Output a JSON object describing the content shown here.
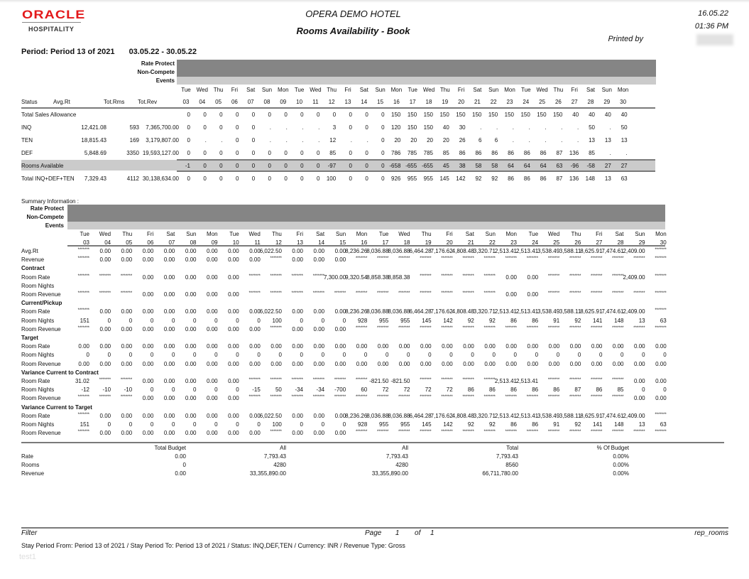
{
  "header": {
    "logo_brand": "ORACLE",
    "logo_sub": "HOSPITALITY",
    "hotel_name": "OPERA DEMO HOTEL",
    "report_title": "Rooms Availability - Book",
    "print_date": "16.05.22",
    "print_time": "01:36 PM",
    "printed_by_label": "Printed by",
    "period_label": "Period: Period 13 of 2021",
    "period_range": "03.05.22 - 30.05.22"
  },
  "bands": {
    "rate_protect": "Rate Protect",
    "non_compete": "Non-Compete",
    "events": "Events"
  },
  "days": [
    {
      "dow": "Tue",
      "d": "03"
    },
    {
      "dow": "Wed",
      "d": "04"
    },
    {
      "dow": "Thu",
      "d": "05"
    },
    {
      "dow": "Fri",
      "d": "06"
    },
    {
      "dow": "Sat",
      "d": "07"
    },
    {
      "dow": "Sun",
      "d": "08"
    },
    {
      "dow": "Mon",
      "d": "09"
    },
    {
      "dow": "Tue",
      "d": "10"
    },
    {
      "dow": "Wed",
      "d": "11"
    },
    {
      "dow": "Thu",
      "d": "12"
    },
    {
      "dow": "Fri",
      "d": "13"
    },
    {
      "dow": "Sat",
      "d": "14"
    },
    {
      "dow": "Sun",
      "d": "15"
    },
    {
      "dow": "Mon",
      "d": "16"
    },
    {
      "dow": "Tue",
      "d": "17"
    },
    {
      "dow": "Wed",
      "d": "18"
    },
    {
      "dow": "Thu",
      "d": "19"
    },
    {
      "dow": "Fri",
      "d": "20"
    },
    {
      "dow": "Sat",
      "d": "21"
    },
    {
      "dow": "Sun",
      "d": "22"
    },
    {
      "dow": "Mon",
      "d": "23"
    },
    {
      "dow": "Tue",
      "d": "24"
    },
    {
      "dow": "Wed",
      "d": "25"
    },
    {
      "dow": "Thu",
      "d": "26"
    },
    {
      "dow": "Fri",
      "d": "27"
    },
    {
      "dow": "Sat",
      "d": "28"
    },
    {
      "dow": "Sun",
      "d": "29"
    },
    {
      "dow": "Mon",
      "d": "30"
    }
  ],
  "main_table": {
    "columns": {
      "status": "Status",
      "avg_rt": "Avg.Rt",
      "tot_rms": "Tot.Rms",
      "tot_rev": "Tot.Rev"
    },
    "rows": [
      {
        "label": "Total Sales Allowance",
        "avg": "",
        "rms": "",
        "rev": "",
        "shaded": false,
        "vals": [
          "0",
          "0",
          "0",
          "0",
          "0",
          "0",
          "0",
          "0",
          "0",
          "0",
          "0",
          "0",
          "0",
          "150",
          "150",
          "150",
          "150",
          "150",
          "150",
          "150",
          "150",
          "150",
          "150",
          "150",
          "40",
          "40",
          "40",
          "40"
        ]
      },
      {
        "label": "INQ",
        "avg": "12,421.08",
        "rms": "593",
        "rev": "7,365,700.00",
        "shaded": false,
        "vals": [
          "0",
          "0",
          "0",
          "0",
          "0",
          ".",
          ".",
          ".",
          ".",
          "3",
          "0",
          "0",
          "0",
          "120",
          "150",
          "150",
          "40",
          "30",
          ".",
          ".",
          ".",
          ".",
          ".",
          ".",
          ".",
          "50",
          ".",
          "50"
        ]
      },
      {
        "label": "TEN",
        "avg": "18,815.43",
        "rms": "169",
        "rev": "3,179,807.00",
        "shaded": false,
        "vals": [
          "0",
          ".",
          ".",
          "0",
          "0",
          ".",
          ".",
          ".",
          ".",
          "12",
          ".",
          ".",
          "0",
          "20",
          "20",
          "20",
          "20",
          "26",
          "6",
          "6",
          ".",
          ".",
          ".",
          ".",
          ".",
          "13",
          "13",
          "13"
        ]
      },
      {
        "label": "DEF",
        "avg": "5,848.69",
        "rms": "3350",
        "rev": "19,593,127.00",
        "shaded": false,
        "vals": [
          "0",
          "0",
          "0",
          "0",
          "0",
          "0",
          "0",
          "0",
          "0",
          "85",
          "0",
          "0",
          "0",
          "786",
          "785",
          "785",
          "85",
          "86",
          "86",
          "86",
          "86",
          "86",
          "86",
          "87",
          "136",
          "85",
          ".",
          "."
        ]
      },
      {
        "label": "Rooms Available",
        "avg": "",
        "rms": "",
        "rev": "",
        "shaded": true,
        "vals": [
          "-1",
          "0",
          "0",
          "0",
          "0",
          "0",
          "0",
          "0",
          "0",
          "-97",
          "0",
          "0",
          "0",
          "-658",
          "-655",
          "-655",
          "45",
          "38",
          "58",
          "58",
          "64",
          "64",
          "64",
          "63",
          "-96",
          "-58",
          "27",
          "27"
        ]
      },
      {
        "label": "Total INQ+DEF+TEN",
        "avg": "7,329.43",
        "rms": "4112",
        "rev": "30,138,634.00",
        "shaded": false,
        "vals": [
          "0",
          "0",
          "0",
          "0",
          "0",
          "0",
          "0",
          "0",
          "0",
          "100",
          "0",
          "0",
          "0",
          "926",
          "955",
          "955",
          "145",
          "142",
          "92",
          "92",
          "86",
          "86",
          "86",
          "87",
          "136",
          "148",
          "13",
          "63"
        ]
      }
    ]
  },
  "summary": {
    "title": "Summary Information :",
    "rows": [
      {
        "label": "Avg.Rt",
        "bold": false,
        "vals": [
          "*******",
          "0.00",
          "0.00",
          "0.00",
          "0.00",
          "0.00",
          "0.00",
          "0.00",
          "0.00",
          "6,022.50",
          "0.00",
          "0.00",
          "0.00",
          "8,236.26",
          "8,036.88",
          "8,036.88",
          "6,464.28",
          "7,176.62",
          "4,808.48",
          "3,320.71",
          "2,513.41",
          "2,513.41",
          "3,538.49",
          "3,588.11",
          "8,625.91",
          "7,474.61",
          "2,409.00",
          "*******"
        ]
      },
      {
        "label": "Revenue",
        "bold": false,
        "vals": [
          "*******",
          "0.00",
          "0.00",
          "0.00",
          "0.00",
          "0.00",
          "0.00",
          "0.00",
          "0.00",
          "*******",
          "0.00",
          "0.00",
          "0.00",
          "*******",
          "*******",
          "*******",
          "*******",
          "*******",
          "*******",
          "*******",
          "*******",
          "*******",
          "*******",
          "*******",
          "*******",
          "*******",
          "*******",
          "*******"
        ]
      },
      {
        "label": "Contract",
        "bold": true,
        "vals": []
      },
      {
        "label": "Room Rate",
        "bold": false,
        "vals": [
          "*******",
          "*******",
          "*******",
          "0.00",
          "0.00",
          "0.00",
          "0.00",
          "0.00",
          "*******",
          "*******",
          "*******",
          "*******",
          "7,300.00",
          "9,320.54",
          "8,858.38",
          "8,858.38",
          "*******",
          "*******",
          "*******",
          "*******",
          "0.00",
          "0.00",
          "*******",
          "*******",
          "*******",
          "*******",
          "2,409.00",
          "*******"
        ]
      },
      {
        "label": "Room Nights",
        "bold": false,
        "vals": []
      },
      {
        "label": "Room Revenue",
        "bold": false,
        "vals": [
          "*******",
          "*******",
          "*******",
          "0.00",
          "0.00",
          "0.00",
          "0.00",
          "0.00",
          "*******",
          "*******",
          "*******",
          "*******",
          "*******",
          "*******",
          "*******",
          "*******",
          "*******",
          "*******",
          "*******",
          "*******",
          "0.00",
          "0.00",
          "*******",
          "*******",
          "*******",
          "*******",
          "*******",
          "*******"
        ]
      },
      {
        "label": "Current/Pickup",
        "bold": true,
        "vals": []
      },
      {
        "label": "Room Rate",
        "bold": false,
        "vals": [
          "*******",
          "0.00",
          "0.00",
          "0.00",
          "0.00",
          "0.00",
          "0.00",
          "0.00",
          "0.00",
          "6,022.50",
          "0.00",
          "0.00",
          "0.00",
          "8,236.26",
          "8,036.88",
          "8,036.88",
          "6,464.28",
          "7,176.62",
          "4,808.48",
          "3,320.71",
          "2,513.41",
          "2,513.41",
          "3,538.49",
          "3,588.11",
          "8,625.91",
          "7,474.61",
          "2,409.00",
          "*******"
        ]
      },
      {
        "label": "Room Nights",
        "bold": false,
        "vals": [
          "151",
          "0",
          "0",
          "0",
          "0",
          "0",
          "0",
          "0",
          "0",
          "100",
          "0",
          "0",
          "0",
          "928",
          "955",
          "955",
          "145",
          "142",
          "92",
          "92",
          "86",
          "86",
          "91",
          "92",
          "141",
          "148",
          "13",
          "63"
        ]
      },
      {
        "label": "Room Revenue",
        "bold": false,
        "vals": [
          "*******",
          "0.00",
          "0.00",
          "0.00",
          "0.00",
          "0.00",
          "0.00",
          "0.00",
          "0.00",
          "*******",
          "0.00",
          "0.00",
          "0.00",
          "*******",
          "*******",
          "*******",
          "*******",
          "*******",
          "*******",
          "*******",
          "*******",
          "*******",
          "*******",
          "*******",
          "*******",
          "*******",
          "*******",
          "*******"
        ]
      },
      {
        "label": "Target",
        "bold": true,
        "vals": []
      },
      {
        "label": "Room Rate",
        "bold": false,
        "vals": [
          "0.00",
          "0.00",
          "0.00",
          "0.00",
          "0.00",
          "0.00",
          "0.00",
          "0.00",
          "0.00",
          "0.00",
          "0.00",
          "0.00",
          "0.00",
          "0.00",
          "0.00",
          "0.00",
          "0.00",
          "0.00",
          "0.00",
          "0.00",
          "0.00",
          "0.00",
          "0.00",
          "0.00",
          "0.00",
          "0.00",
          "0.00",
          "0.00"
        ]
      },
      {
        "label": "Room Nights",
        "bold": false,
        "vals": [
          "0",
          "0",
          "0",
          "0",
          "0",
          "0",
          "0",
          "0",
          "0",
          "0",
          "0",
          "0",
          "0",
          "0",
          "0",
          "0",
          "0",
          "0",
          "0",
          "0",
          "0",
          "0",
          "0",
          "0",
          "0",
          "0",
          "0",
          "0"
        ]
      },
      {
        "label": "Room Revenue",
        "bold": false,
        "vals": [
          "0.00",
          "0.00",
          "0.00",
          "0.00",
          "0.00",
          "0.00",
          "0.00",
          "0.00",
          "0.00",
          "0.00",
          "0.00",
          "0.00",
          "0.00",
          "0.00",
          "0.00",
          "0.00",
          "0.00",
          "0.00",
          "0.00",
          "0.00",
          "0.00",
          "0.00",
          "0.00",
          "0.00",
          "0.00",
          "0.00",
          "0.00",
          "0.00"
        ]
      },
      {
        "label": "Variance Current to Contract",
        "bold": true,
        "vals": []
      },
      {
        "label": "Room Rate",
        "bold": false,
        "vals": [
          "31.02",
          "*******",
          "*******",
          "0.00",
          "0.00",
          "0.00",
          "0.00",
          "0.00",
          "*******",
          "*******",
          "*******",
          "*******",
          "*******",
          "*******",
          "-821.50",
          "-821.50",
          "*******",
          "*******",
          "*******",
          "*******",
          "2,513.41",
          "2,513.41",
          "*******",
          "*******",
          "*******",
          "*******",
          "0.00",
          "0.00"
        ]
      },
      {
        "label": "Room Nights",
        "bold": false,
        "vals": [
          "-12",
          "-10",
          "-10",
          "0",
          "0",
          "0",
          "0",
          "0",
          "-15",
          "50",
          "-34",
          "-34",
          "-700",
          "60",
          "72",
          "72",
          "72",
          "72",
          "86",
          "86",
          "86",
          "86",
          "86",
          "87",
          "86",
          "85",
          "0",
          "0"
        ]
      },
      {
        "label": "Room Revenue",
        "bold": false,
        "vals": [
          "*******",
          "*******",
          "*******",
          "0.00",
          "0.00",
          "0.00",
          "0.00",
          "0.00",
          "*******",
          "*******",
          "*******",
          "*******",
          "*******",
          "*******",
          "*******",
          "*******",
          "*******",
          "*******",
          "*******",
          "*******",
          "*******",
          "*******",
          "*******",
          "*******",
          "*******",
          "*******",
          "0.00",
          "0.00"
        ]
      },
      {
        "label": "Variance Current to Target",
        "bold": true,
        "vals": []
      },
      {
        "label": "Room Rate",
        "bold": false,
        "vals": [
          "*******",
          "0.00",
          "0.00",
          "0.00",
          "0.00",
          "0.00",
          "0.00",
          "0.00",
          "0.00",
          "6,022.50",
          "0.00",
          "0.00",
          "0.00",
          "8,236.26",
          "8,036.88",
          "8,036.88",
          "6,464.28",
          "7,176.62",
          "4,808.48",
          "3,320.71",
          "2,513.41",
          "2,513.41",
          "3,538.49",
          "3,588.11",
          "8,625.91",
          "7,474.61",
          "2,409.00",
          "*******"
        ]
      },
      {
        "label": "Room Nights",
        "bold": false,
        "vals": [
          "151",
          "0",
          "0",
          "0",
          "0",
          "0",
          "0",
          "0",
          "0",
          "100",
          "0",
          "0",
          "0",
          "928",
          "955",
          "955",
          "145",
          "142",
          "92",
          "92",
          "86",
          "86",
          "91",
          "92",
          "141",
          "148",
          "13",
          "63"
        ]
      },
      {
        "label": "Room Revenue",
        "bold": false,
        "vals": [
          "*******",
          "0.00",
          "0.00",
          "0.00",
          "0.00",
          "0.00",
          "0.00",
          "0.00",
          "0.00",
          "*******",
          "0.00",
          "0.00",
          "0.00",
          "*******",
          "*******",
          "*******",
          "*******",
          "*******",
          "*******",
          "*******",
          "*******",
          "*******",
          "*******",
          "*******",
          "*******",
          "*******",
          "*******",
          "*******"
        ]
      }
    ]
  },
  "totals": {
    "headers": [
      "Total Budget",
      "All",
      "All",
      "Total",
      "% Of Budget"
    ],
    "rows": [
      {
        "label": "Rate",
        "vals": [
          "0.00",
          "7,793.43",
          "7,793.43",
          "7,793.43",
          "0.00%"
        ]
      },
      {
        "label": "Rooms",
        "vals": [
          "0",
          "4280",
          "4280",
          "8560",
          "0.00%"
        ]
      },
      {
        "label": "Revenue",
        "vals": [
          "0.00",
          "33,355,890.00",
          "33,355,890.00",
          "66,711,780.00",
          "0.00%"
        ]
      }
    ]
  },
  "footer": {
    "filter_label": "Filter",
    "page_label": "Page",
    "page_num": "1",
    "of_label": "of",
    "page_total": "1",
    "report_id": "rep_rooms",
    "filter_text": "Stay Period From: Period 13 of 2021 / Stay Period To: Period 13 of 2021 / Status: INQ,DEF,TEN / Currency: INR / Revenue Type: Gross",
    "watermark": "test1"
  }
}
